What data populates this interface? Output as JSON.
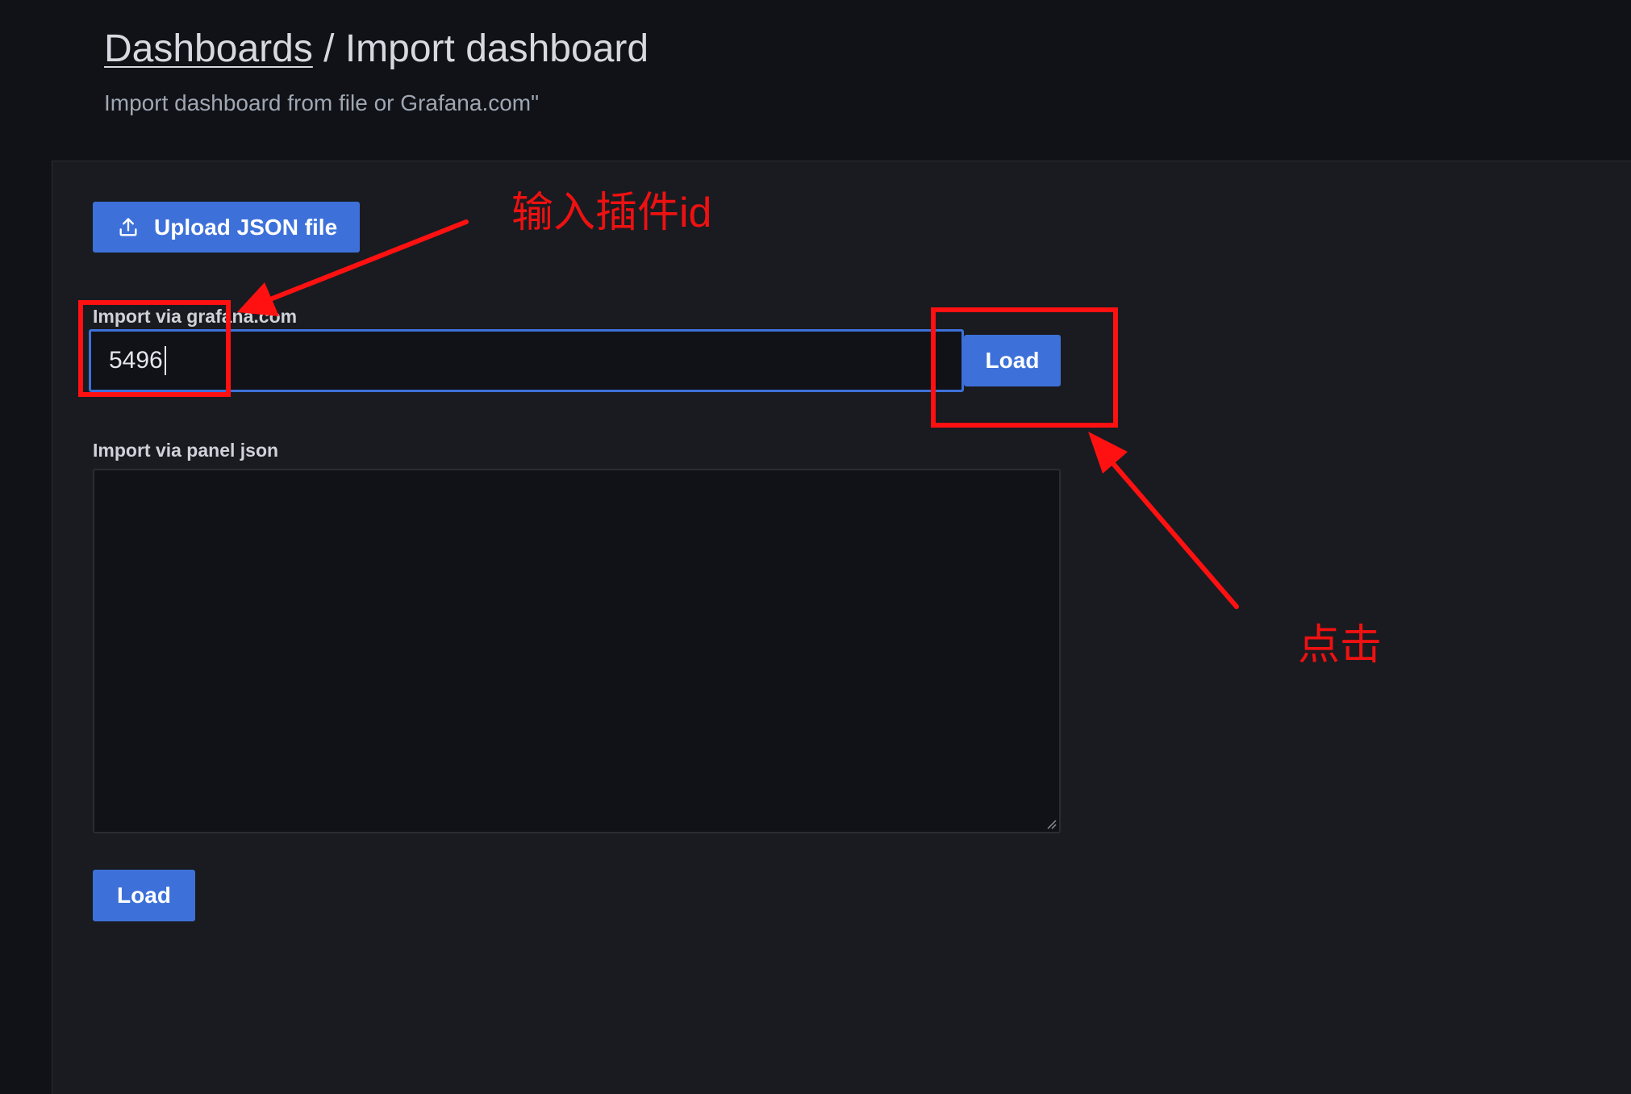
{
  "header": {
    "breadcrumb_parent": "Dashboards",
    "breadcrumb_separator": " / ",
    "page_title": "Import dashboard",
    "subtitle": "Import dashboard from file or Grafana.com\""
  },
  "upload": {
    "label": "Upload JSON file",
    "icon": "upload-icon"
  },
  "grafana_com": {
    "label": "Import via grafana.com",
    "value": "5496",
    "button_label": "Load"
  },
  "panel_json": {
    "label": "Import via panel json",
    "value": "",
    "button_label": "Load"
  },
  "annotations": {
    "input_note": "输入插件id",
    "click_note": "点击",
    "color": "#ff1111"
  },
  "colors": {
    "background": "#111217",
    "panel": "#1a1b20",
    "primary_button": "#3d71d9",
    "input_focus_border": "#3d71d9"
  }
}
